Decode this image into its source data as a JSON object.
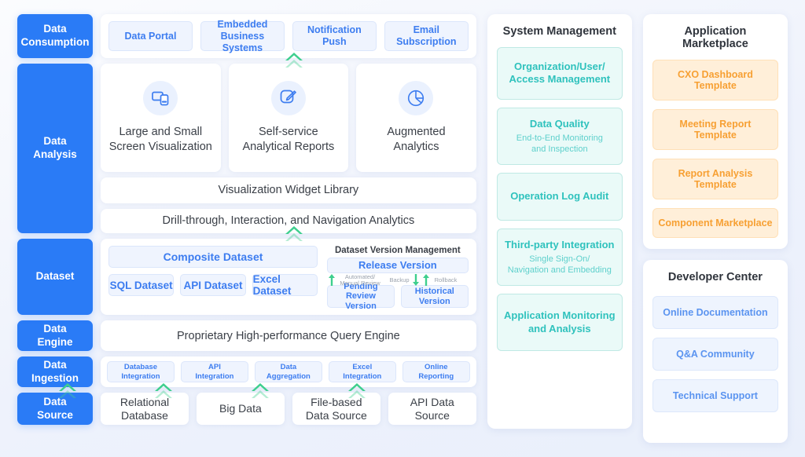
{
  "stages": {
    "consumption": "Data\nConsumption",
    "analysis": "Data\nAnalysis",
    "dataset": "Dataset",
    "engine": "Data\nEngine",
    "ingestion": "Data\nIngestion",
    "source": "Data\nSource"
  },
  "consumption": {
    "chips": [
      "Data Portal",
      "Embedded\nBusiness Systems",
      "Notification\nPush",
      "Email\nSubscription"
    ]
  },
  "analysis": {
    "cards": [
      {
        "icon": "screens-icon",
        "label": "Large and Small\nScreen Visualization"
      },
      {
        "icon": "edit-square-icon",
        "label": "Self-service\nAnalytical Reports"
      },
      {
        "icon": "pie-chart-icon",
        "label": "Augmented\nAnalytics"
      }
    ],
    "widget_library": "Visualization Widget Library",
    "drill_through": "Drill-through, Interaction, and Navigation Analytics"
  },
  "dataset": {
    "composite": "Composite Dataset",
    "sources": [
      "SQL Dataset",
      "API Dataset",
      "Excel Dataset"
    ],
    "version_management": {
      "title": "Dataset Version Management",
      "release": "Release Version",
      "review_label": "Automated/\nManual Review",
      "backup_label": "Backup",
      "rollback_label": "Rollback",
      "pending": "Pending Review\nVersion",
      "historical": "Historical\nVersion"
    }
  },
  "engine": {
    "label": "Proprietary High-performance Query Engine"
  },
  "ingestion": {
    "chips": [
      "Database\nIntegration",
      "API\nIntegration",
      "Data\nAggregation",
      "Excel\nIntegration",
      "Online\nReporting"
    ]
  },
  "source": {
    "cards": [
      "Relational\nDatabase",
      "Big Data",
      "File-based\nData Source",
      "API Data\nSource"
    ]
  },
  "system_management": {
    "title": "System Management",
    "items": [
      {
        "title": "Organization/User/\nAccess Management",
        "sub": ""
      },
      {
        "title": "Data Quality",
        "sub": "End-to-End Monitoring\nand Inspection"
      },
      {
        "title": "Operation Log Audit",
        "sub": ""
      },
      {
        "title": "Third-party Integration",
        "sub": "Single Sign-On/\nNavigation and Embedding"
      },
      {
        "title": "Application Monitoring\nand Analysis",
        "sub": ""
      }
    ]
  },
  "application_marketplace": {
    "title": "Application Marketplace",
    "items": [
      "CXO Dashboard Template",
      "Meeting Report Template",
      "Report Analysis Template",
      "Component Marketplace"
    ]
  },
  "developer_center": {
    "title": "Developer Center",
    "items": [
      "Online Documentation",
      "Q&A Community",
      "Technical Support"
    ]
  },
  "colors": {
    "stage_blue": "#2a7bf6",
    "chip_blue_text": "#3d7df0",
    "mint": "#2fc2bd",
    "orange": "#f7a033",
    "arrow_green": "#3ecf8e"
  }
}
